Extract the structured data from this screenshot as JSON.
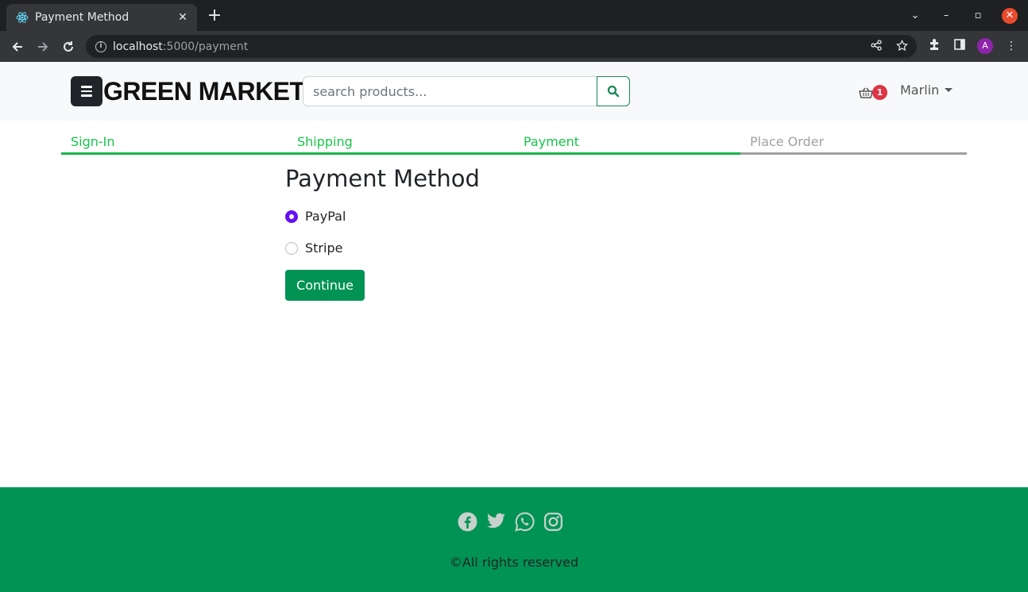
{
  "browser": {
    "tab_title": "Payment Method",
    "url_host": "localhost",
    "url_path": ":5000/payment",
    "profile_initial": "A"
  },
  "header": {
    "brand": "GREEN MARKET",
    "search_placeholder": "search products...",
    "cart_count": "1",
    "user_name": "Marlin"
  },
  "steps": [
    {
      "label": "Sign-In",
      "active": true
    },
    {
      "label": "Shipping",
      "active": true
    },
    {
      "label": "Payment",
      "active": true
    },
    {
      "label": "Place Order",
      "active": false
    }
  ],
  "main": {
    "title": "Payment Method",
    "options": [
      {
        "label": "PayPal",
        "selected": true
      },
      {
        "label": "Stripe",
        "selected": false
      }
    ],
    "continue_label": "Continue"
  },
  "footer": {
    "icons": [
      "facebook-icon",
      "twitter-icon",
      "whatsapp-icon",
      "instagram-icon"
    ],
    "copyright": "©All rights reserved"
  },
  "colors": {
    "brand_green": "#009353",
    "step_active": "#19c34b",
    "radio_selected": "#6610f2",
    "badge": "#dc3545"
  }
}
